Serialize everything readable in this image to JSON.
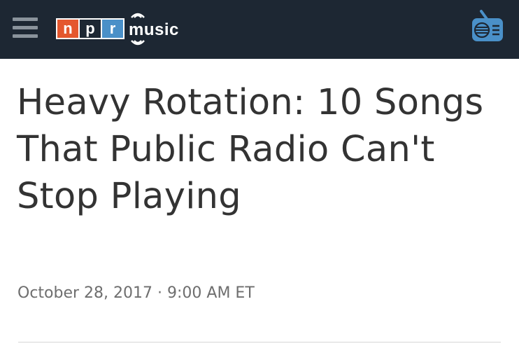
{
  "header": {
    "menu_icon": "hamburger-menu-icon",
    "logo": {
      "letters": [
        "n",
        "p",
        "r"
      ],
      "letter_colors": [
        "#e4572e",
        "#1d2733",
        "#4a90c8"
      ],
      "section": "music"
    },
    "radio_icon": "radio-icon",
    "colors": {
      "bar": "#1d2733",
      "radio": "#4a90c8"
    }
  },
  "article": {
    "title": "Heavy Rotation: 10 Songs That Public Radio Can't Stop Playing",
    "date": "October 28, 2017",
    "separator": "·",
    "time": "9:00 AM ET"
  }
}
